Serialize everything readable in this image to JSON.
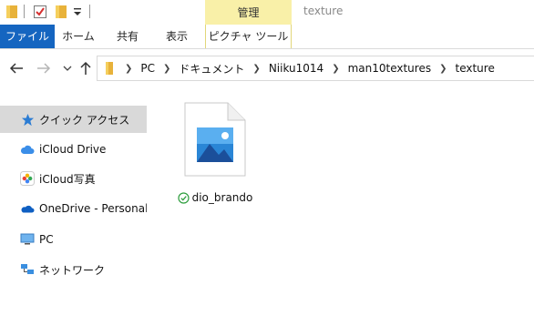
{
  "window": {
    "contextual_header": "管理",
    "title": "texture"
  },
  "ribbon": {
    "tabs": [
      {
        "label": "ファイル"
      },
      {
        "label": "ホーム"
      },
      {
        "label": "共有"
      },
      {
        "label": "表示"
      },
      {
        "label": "ピクチャ ツール"
      }
    ]
  },
  "address": {
    "crumbs": [
      "PC",
      "ドキュメント",
      "Niiku1014",
      "man10textures",
      "texture"
    ]
  },
  "sidebar": {
    "items": [
      {
        "label": "クイック アクセス",
        "icon": "star-icon",
        "selected": true
      },
      {
        "label": "iCloud Drive",
        "icon": "icloud-icon"
      },
      {
        "label": "iCloud写真",
        "icon": "photos-icon"
      },
      {
        "label": "OneDrive - Personal",
        "icon": "onedrive-icon"
      },
      {
        "label": "PC",
        "icon": "pc-icon"
      },
      {
        "label": "ネットワーク",
        "icon": "network-icon"
      }
    ]
  },
  "files": [
    {
      "name": "dio_brando",
      "icon": "image-file-icon",
      "status": "synced-check-icon"
    }
  ],
  "colors": {
    "accent": "#1565c0",
    "contextual": "#f9f0a8",
    "selected": "#d9d9d9",
    "sync_ok": "#2e9e3e"
  }
}
